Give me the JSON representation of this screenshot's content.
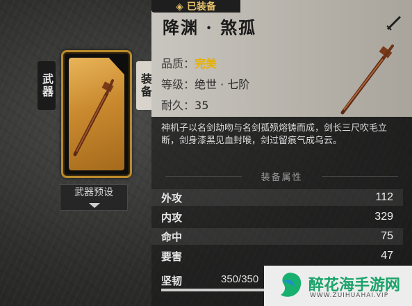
{
  "tabs": {
    "weapon": "武器",
    "equipment": "装备"
  },
  "preset_button": "武器预设",
  "item": {
    "name": "降渊 · 煞孤",
    "equipped_badge": "◈ 已装备",
    "quality_label": "品质：",
    "quality_value": "完美",
    "quality_color": "#e8b000",
    "level_label": "等级：",
    "level_value": "绝世 · 七阶",
    "durability_label": "耐久：",
    "durability_value": "35",
    "description": "神机子以名剑劫吻与名剑孤殒熔铸而成，剑长三尺吹毛立断，剑身漆黑见血封喉，剑过留痕气成乌云。"
  },
  "attributes": {
    "heading": "装备属性",
    "stats": [
      {
        "name": "外攻",
        "value": "112"
      },
      {
        "name": "内攻",
        "value": "329"
      },
      {
        "name": "命中",
        "value": "75"
      },
      {
        "name": "要害",
        "value": "47"
      }
    ]
  },
  "toughness": {
    "label": "坚韧",
    "value": "350/350",
    "fraction": 1.0
  },
  "watermark": {
    "name": "醉花海手游网",
    "url": "WWW.ZUIHUAHAI.VIP"
  }
}
